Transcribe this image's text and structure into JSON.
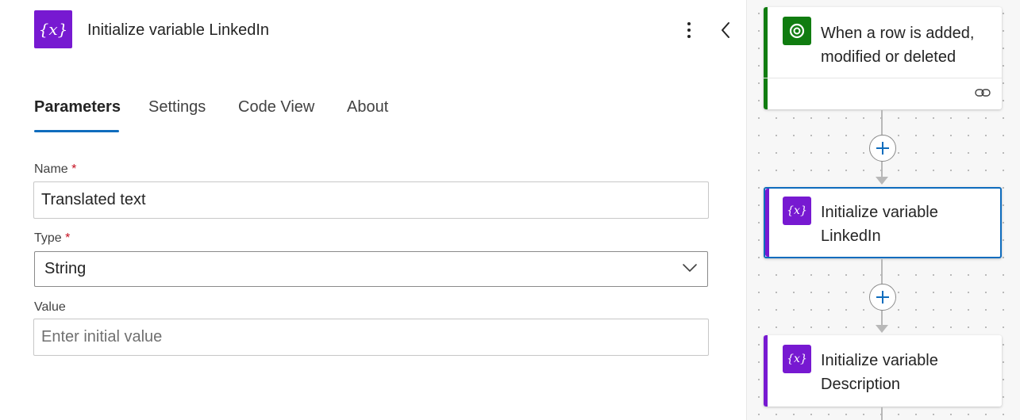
{
  "panel": {
    "title": "Initialize variable LinkedIn",
    "icon": "variable-icon",
    "tabs": [
      {
        "label": "Parameters",
        "active": true
      },
      {
        "label": "Settings",
        "active": false
      },
      {
        "label": "Code View",
        "active": false
      },
      {
        "label": "About",
        "active": false
      }
    ],
    "fields": {
      "name": {
        "label": "Name",
        "required_mark": "*",
        "value": "Translated text"
      },
      "type": {
        "label": "Type",
        "required_mark": "*",
        "value": "String"
      },
      "value": {
        "label": "Value",
        "placeholder": "Enter initial value",
        "value": ""
      }
    }
  },
  "flow": {
    "cards": [
      {
        "title": "When a row is added, modified or deleted",
        "icon": "dataverse-icon",
        "accent": "#107c10"
      },
      {
        "title": "Initialize variable LinkedIn",
        "icon": "variable-icon",
        "accent": "#7719d1",
        "selected": true
      },
      {
        "title": "Initialize variable Description",
        "icon": "variable-icon",
        "accent": "#7719d1"
      }
    ]
  },
  "colors": {
    "brand_blue": "#0f6cbd",
    "variable_purple": "#7719d1",
    "dataverse_green": "#107c10"
  }
}
